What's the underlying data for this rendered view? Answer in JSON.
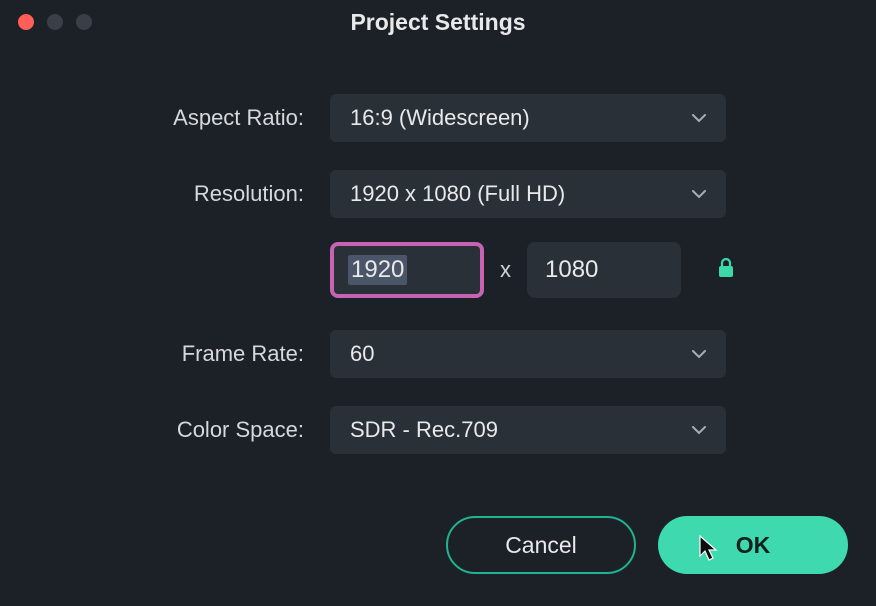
{
  "window": {
    "title": "Project Settings"
  },
  "fields": {
    "aspect_ratio": {
      "label": "Aspect Ratio:",
      "value": "16:9 (Widescreen)"
    },
    "resolution": {
      "label": "Resolution:",
      "value": "1920 x 1080 (Full HD)",
      "width": "1920",
      "height": "1080",
      "separator": "x"
    },
    "frame_rate": {
      "label": "Frame Rate:",
      "value": "60"
    },
    "color_space": {
      "label": "Color Space:",
      "value": "SDR - Rec.709"
    }
  },
  "buttons": {
    "cancel": "Cancel",
    "ok": "OK"
  }
}
